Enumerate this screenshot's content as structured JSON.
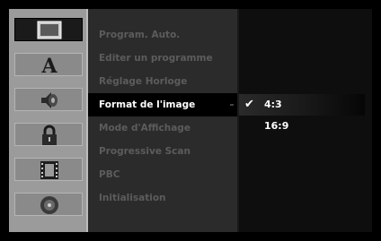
{
  "sidebar": {
    "icons": [
      {
        "name": "picture-tv-icon",
        "selected": true
      },
      {
        "name": "language-a-icon",
        "selected": false
      },
      {
        "name": "audio-speaker-icon",
        "selected": false
      },
      {
        "name": "lock-icon",
        "selected": false
      },
      {
        "name": "film-recording-icon",
        "selected": false
      },
      {
        "name": "disc-icon",
        "selected": false
      }
    ]
  },
  "menu": {
    "items": [
      {
        "label": "Program. Auto."
      },
      {
        "label": "Editer un programme"
      },
      {
        "label": "Réglage Horloge"
      },
      {
        "label": "Format de l'image"
      },
      {
        "label": "Mode d'Affichage"
      },
      {
        "label": "Progressive Scan"
      },
      {
        "label": "PBC"
      },
      {
        "label": "Initialisation"
      }
    ],
    "selected_index": 3
  },
  "options": {
    "items": [
      {
        "label": "4:3",
        "checked": true
      },
      {
        "label": "16:9",
        "checked": false
      }
    ],
    "check_glyph": "✔"
  }
}
